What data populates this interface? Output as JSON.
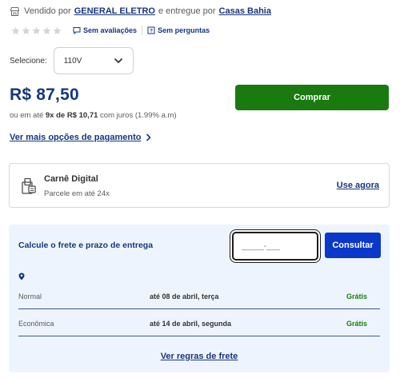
{
  "seller": {
    "sold_by_prefix": "Vendido por",
    "seller_name": "GENERAL ELETRO",
    "delivered_by_prefix": "e entregue por",
    "delivery_partner": "Casas Bahia"
  },
  "rating": {
    "stars": 5,
    "filled_stars": 0,
    "reviews_label": "Sem avaliações",
    "questions_label": "Sem perguntas"
  },
  "voltage": {
    "label": "Selecione:",
    "selected": "110V"
  },
  "pricing": {
    "price": "R$ 87,50",
    "installments_prefix": "ou em até",
    "installments_count": "9x de R$ 10,71",
    "installments_suffix": "com juros (1.99% a.m)",
    "buy_label": "Comprar",
    "more_payment_options": "Ver mais opções de pagamento"
  },
  "carne": {
    "title": "Carnê Digital",
    "subtitle": "Parcele em até 24x",
    "cta": "Use agora"
  },
  "freight": {
    "title": "Calcule o frete e prazo de entrega",
    "cep_placeholder": "_____-___",
    "calculate_label": "Consultar",
    "options": [
      {
        "name": "Normal",
        "date": "até 08 de abril, terça",
        "price": "Grátis"
      },
      {
        "name": "Econômica",
        "date": "até 14 de abril, segunda",
        "price": "Grátis"
      }
    ],
    "rules_link": "Ver regras de frete"
  },
  "colors": {
    "brand_blue": "#16367f",
    "buy_green": "#1a7a10",
    "consult_blue": "#0c38c9",
    "freight_bg": "#eef4fd"
  }
}
